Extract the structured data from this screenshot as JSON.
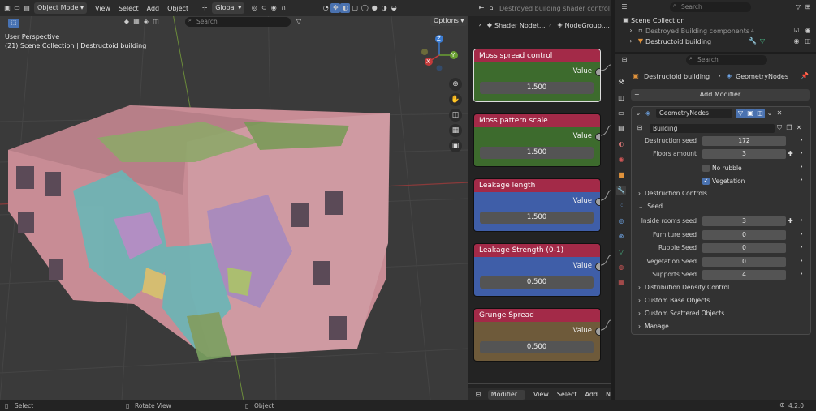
{
  "viewport": {
    "mode": "Object Mode",
    "menus": [
      "View",
      "Select",
      "Add",
      "Object"
    ],
    "transform_orientation": "Global",
    "search_placeholder": "Search",
    "options_label": "Options",
    "overlay_line1": "User Perspective",
    "overlay_line2": "(21) Scene Collection | Destructoid building",
    "gizmo": {
      "x": "X",
      "y": "Y",
      "z": "Z"
    }
  },
  "node_editor": {
    "header_title": "Destroyed building shader control",
    "breadcrumb_1": "Shader Nodet...",
    "breadcrumb_2": "NodeGroup....",
    "nodes": [
      {
        "title": "Moss spread control",
        "output": "Value",
        "value": "1.500",
        "header_color": "#a32a48",
        "body_color": "#3d6b2d"
      },
      {
        "title": "Moss pattern scale",
        "output": "Value",
        "value": "1.500",
        "header_color": "#a32a48",
        "body_color": "#3d6b2d"
      },
      {
        "title": "Leakage length",
        "output": "Value",
        "value": "1.500",
        "header_color": "#a32a48",
        "body_color": "#3f5ea8"
      },
      {
        "title": "Leakage Strength (0-1)",
        "output": "Value",
        "value": "0.500",
        "header_color": "#a32a48",
        "body_color": "#3f5ea8"
      },
      {
        "title": "Grunge Spread",
        "output": "Value",
        "value": "0.500",
        "header_color": "#a32a48",
        "body_color": "#6e5a3a"
      }
    ],
    "footer_mode": "Modifier",
    "footer_menus": [
      "View",
      "Select",
      "Add",
      "N"
    ]
  },
  "outliner": {
    "search_placeholder": "Search",
    "scene_collection": "Scene Collection",
    "items": [
      {
        "label": "Destroyed Building components",
        "count": "4"
      },
      {
        "label": "Destructoid building"
      }
    ]
  },
  "properties": {
    "search_placeholder": "Search",
    "breadcrumb_object": "Destructoid building",
    "breadcrumb_modifier": "GeometryNodes",
    "add_modifier": "Add Modifier",
    "modifier_name": "GeometryNodes",
    "node_group": "Building",
    "fields": [
      {
        "label": "Destruction seed",
        "value": "172"
      },
      {
        "label": "Floors amount",
        "value": "3"
      }
    ],
    "checkboxes": [
      {
        "label": "No rubble",
        "checked": false
      },
      {
        "label": "Vegetation",
        "checked": true
      }
    ],
    "panel_destruction": "Destruction Controls",
    "panel_seed": "Seed",
    "seed_fields": [
      {
        "label": "Inside rooms seed",
        "value": "3"
      },
      {
        "label": "Furniture seed",
        "value": "0"
      },
      {
        "label": "Rubble Seed",
        "value": "0"
      },
      {
        "label": "Vegetation Seed",
        "value": "0"
      },
      {
        "label": "Supports Seed",
        "value": "4"
      }
    ],
    "panels_closed": [
      "Distribution Density Control",
      "Custom Base Objects",
      "Custom Scattered Objects",
      "Manage"
    ]
  },
  "status_bar": {
    "select": "Select",
    "rotate": "Rotate View",
    "object": "Object",
    "version": "4.2.0"
  }
}
